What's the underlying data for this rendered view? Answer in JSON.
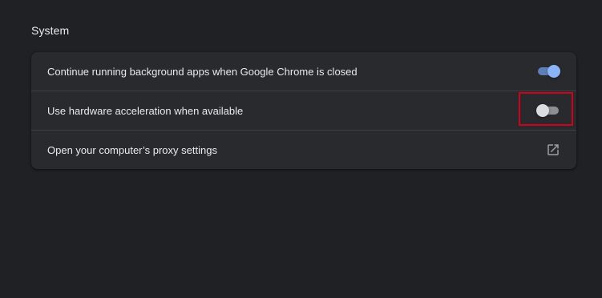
{
  "section": {
    "title": "System"
  },
  "settings": [
    {
      "label": "Continue running background apps when Google Chrome is closed",
      "control": "toggle",
      "state": "on"
    },
    {
      "label": "Use hardware acceleration when available",
      "control": "toggle",
      "state": "off",
      "highlighted": true
    },
    {
      "label": "Open your computer’s proxy settings",
      "control": "external-link",
      "icon": "open-in-new-icon"
    }
  ],
  "colors": {
    "background": "#202124",
    "card": "#292a2d",
    "text": "#e8eaed",
    "toggle_on_knob": "#8ab4f8",
    "toggle_on_track": "#5f7fb8",
    "toggle_off_knob": "#dadce0",
    "toggle_off_track": "#8d8f93",
    "highlight_border": "#d0021b",
    "divider": "#3c4043"
  }
}
